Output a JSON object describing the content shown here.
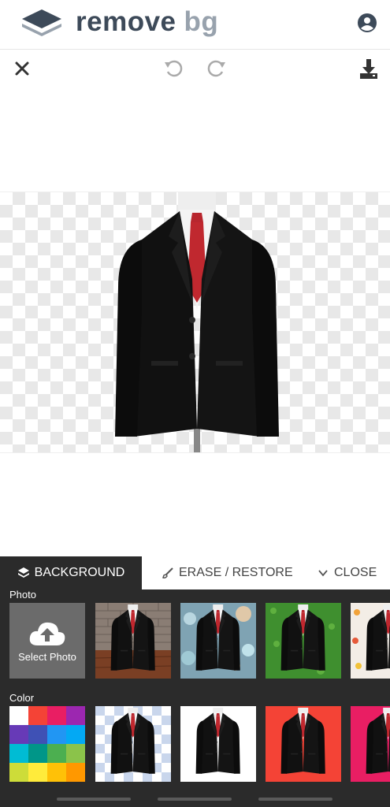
{
  "header": {
    "brand_part1": "remove",
    "brand_part2": "bg",
    "logo_icon": "layers-logo-icon",
    "account_icon": "account-circle-icon"
  },
  "toolbar": {
    "close_icon": "close-icon",
    "undo_icon": "undo-icon",
    "redo_icon": "redo-icon",
    "download_icon": "download-icon"
  },
  "panel": {
    "tabs": [
      {
        "label": "BACKGROUND",
        "icon": "layers-icon",
        "active": true
      },
      {
        "label": "ERASE / RESTORE",
        "icon": "brush-icon",
        "active": false
      },
      {
        "label": "CLOSE",
        "icon": "chevron-down-icon",
        "active": false
      }
    ],
    "photo_label": "Photo",
    "select_photo_label": "Select Photo",
    "color_label": "Color",
    "photo_backgrounds": [
      "brick-wall-wood-floor",
      "bokeh-lights",
      "green-grass",
      "fruit-pattern"
    ],
    "color_backgrounds": [
      "transparent",
      "white",
      "red",
      "pink"
    ],
    "palette_colors": [
      "#ffffff",
      "#f44336",
      "#e91e63",
      "#9c27b0",
      "#673ab7",
      "#3f51b5",
      "#2196f3",
      "#03a9f4",
      "#00bcd4",
      "#009688",
      "#4caf50",
      "#8bc34a",
      "#cddc39",
      "#ffeb3b",
      "#ffc107",
      "#ff9800"
    ]
  },
  "colors": {
    "panel_bg": "#2b2b2b",
    "brand_dark": "#3d4a59",
    "brand_light": "#98a2ad"
  }
}
